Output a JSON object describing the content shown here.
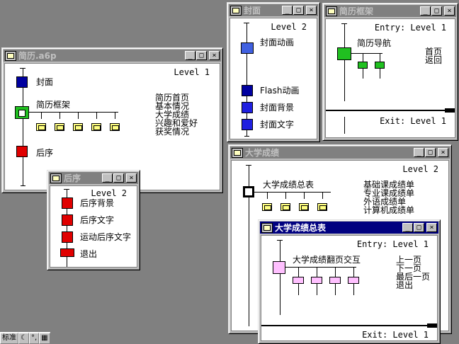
{
  "windows": {
    "resume": {
      "title": "简历.a6p",
      "level": "Level 1",
      "items": [
        "封面",
        "简历框架",
        "后序"
      ],
      "list": [
        "简历首页",
        "基本情况",
        "大学成绩",
        "兴趣和爱好",
        "获奖情况"
      ]
    },
    "cover": {
      "title": "封面",
      "level": "Level 2",
      "items": [
        "封面动画",
        "Flash动画",
        "封面背景",
        "封面文字"
      ]
    },
    "frame": {
      "title": "简历框架",
      "entry": "Entry: Level 1",
      "exit": "Exit: Level 1",
      "nav": "简历导航",
      "list": [
        "首页",
        "返回"
      ]
    },
    "epilogue": {
      "title": "后序",
      "level": "Level 2",
      "items": [
        "后序背景",
        "后序文字",
        "运动后序文字",
        "退出"
      ]
    },
    "grades": {
      "title": "大学成绩",
      "level": "Level 2",
      "item": "大学成绩总表",
      "list": [
        "基础课成绩单",
        "专业课成绩单",
        "外语成绩单",
        "计算机成绩单"
      ]
    },
    "gradesTable": {
      "title": "大学成绩总表",
      "entry": "Entry: Level 1",
      "exit": "Exit: Level 1",
      "interaction": "大学成绩翻页交互",
      "list": [
        "上一页",
        "下一页",
        "最后一页",
        "退出"
      ]
    }
  },
  "titlebar_buttons": {
    "min": "_",
    "max": "□",
    "close": "×"
  },
  "taskbar": {
    "ime": "标准"
  },
  "colors": {
    "inactive_title": "#808080",
    "active_title": "#000080",
    "display_icon": "#0000a0",
    "framework_icon": "#20c020",
    "red_icon": "#e00000"
  }
}
